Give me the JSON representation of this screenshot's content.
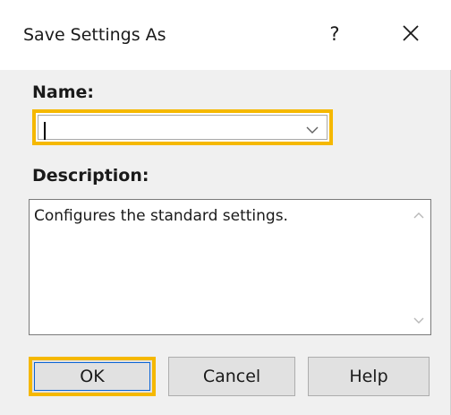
{
  "dialog": {
    "title": "Save Settings As",
    "help_glyph": "?",
    "close_icon": "close-icon"
  },
  "name": {
    "label": "Name:",
    "value": "",
    "dropdown_icon": "chevron-down-icon"
  },
  "description": {
    "label": "Description:",
    "value": "Configures the standard settings."
  },
  "buttons": {
    "ok": "OK",
    "cancel": "Cancel",
    "help": "Help"
  },
  "colors": {
    "highlight": "#f5b800",
    "focus": "#0a64d6",
    "dialog_bg": "#f0f0f0",
    "button_bg": "#e1e1e1"
  }
}
